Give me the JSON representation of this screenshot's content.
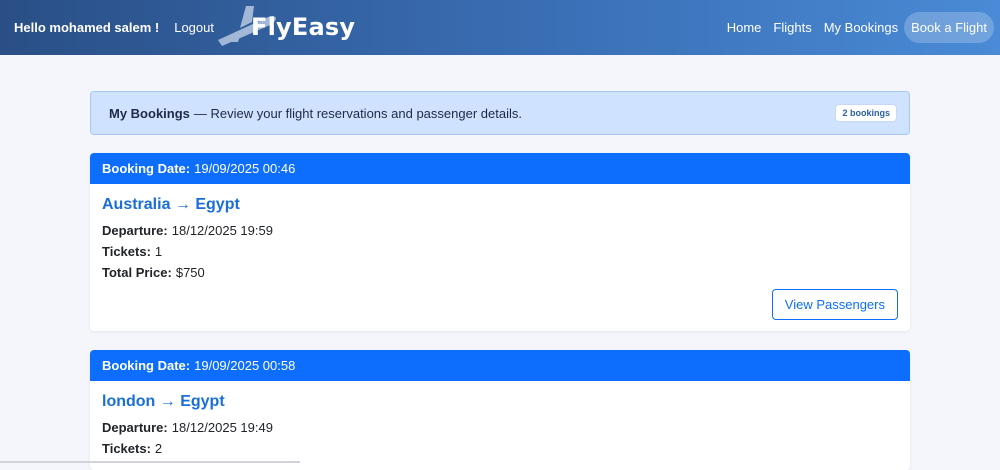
{
  "navbar": {
    "greeting": "Hello mohamed salem !",
    "logout": "Logout",
    "brand": "FlyEasy",
    "links": [
      "Home",
      "Flights",
      "My Bookings"
    ],
    "cta": "Book a Flight"
  },
  "info": {
    "title": "My Bookings",
    "description": "— Review your flight reservations and passenger details.",
    "count": "2 bookings"
  },
  "labels": {
    "booking_date": "Booking Date:",
    "departure": "Departure:",
    "tickets": "Tickets:",
    "total_price": "Total Price:",
    "view_passengers": "View Passengers"
  },
  "bookings": [
    {
      "booking_date": "19/09/2025 00:46",
      "route": "Australia → Egypt",
      "departure": "18/12/2025 19:59",
      "tickets": "1",
      "total_price": "$750"
    },
    {
      "booking_date": "19/09/2025 00:58",
      "route": "london → Egypt",
      "departure": "18/12/2025 19:49",
      "tickets": "2"
    }
  ],
  "colors": {
    "primary": "#0d6efd",
    "info_bg": "#cfe2ff",
    "route": "#1a6fd6"
  }
}
